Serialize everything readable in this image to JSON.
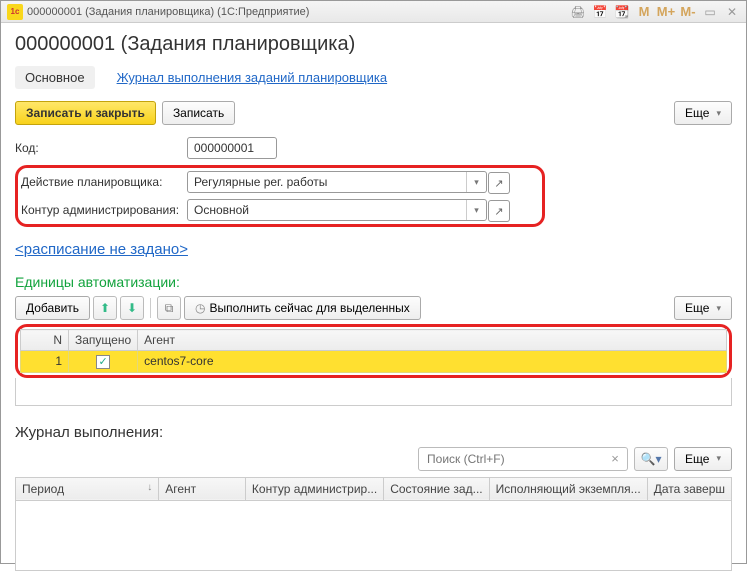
{
  "titlebar": {
    "text": "000000001 (Задания планировщика)  (1С:Предприятие)"
  },
  "header": {
    "title": "000000001 (Задания планировщика)"
  },
  "tabs": {
    "main": "Основное",
    "log": "Журнал выполнения заданий планировщика"
  },
  "toolbar": {
    "save_close": "Записать и закрыть",
    "save": "Записать",
    "more": "Еще"
  },
  "form": {
    "code_label": "Код:",
    "code_value": "000000001",
    "action_label": "Действие планировщика:",
    "action_value": "Регулярные рег. работы",
    "circuit_label": "Контур администрирования:",
    "circuit_value": "Основной"
  },
  "schedule": {
    "link": "<расписание не задано>"
  },
  "units": {
    "title": "Единицы автоматизации:",
    "add": "Добавить",
    "run_selected": "Выполнить сейчас для выделенных",
    "cols": {
      "n": "N",
      "launched": "Запущено",
      "agent": "Агент"
    },
    "rows": [
      {
        "n": "1",
        "launched": true,
        "agent": "centos7-core"
      }
    ]
  },
  "log": {
    "title": "Журнал выполнения:",
    "search_placeholder": "Поиск (Ctrl+F)",
    "cols": {
      "period": "Период",
      "agent": "Агент",
      "circuit": "Контур администрир...",
      "status": "Состояние зад...",
      "executor": "Исполняющий экземпля...",
      "finished": "Дата заверш"
    }
  }
}
